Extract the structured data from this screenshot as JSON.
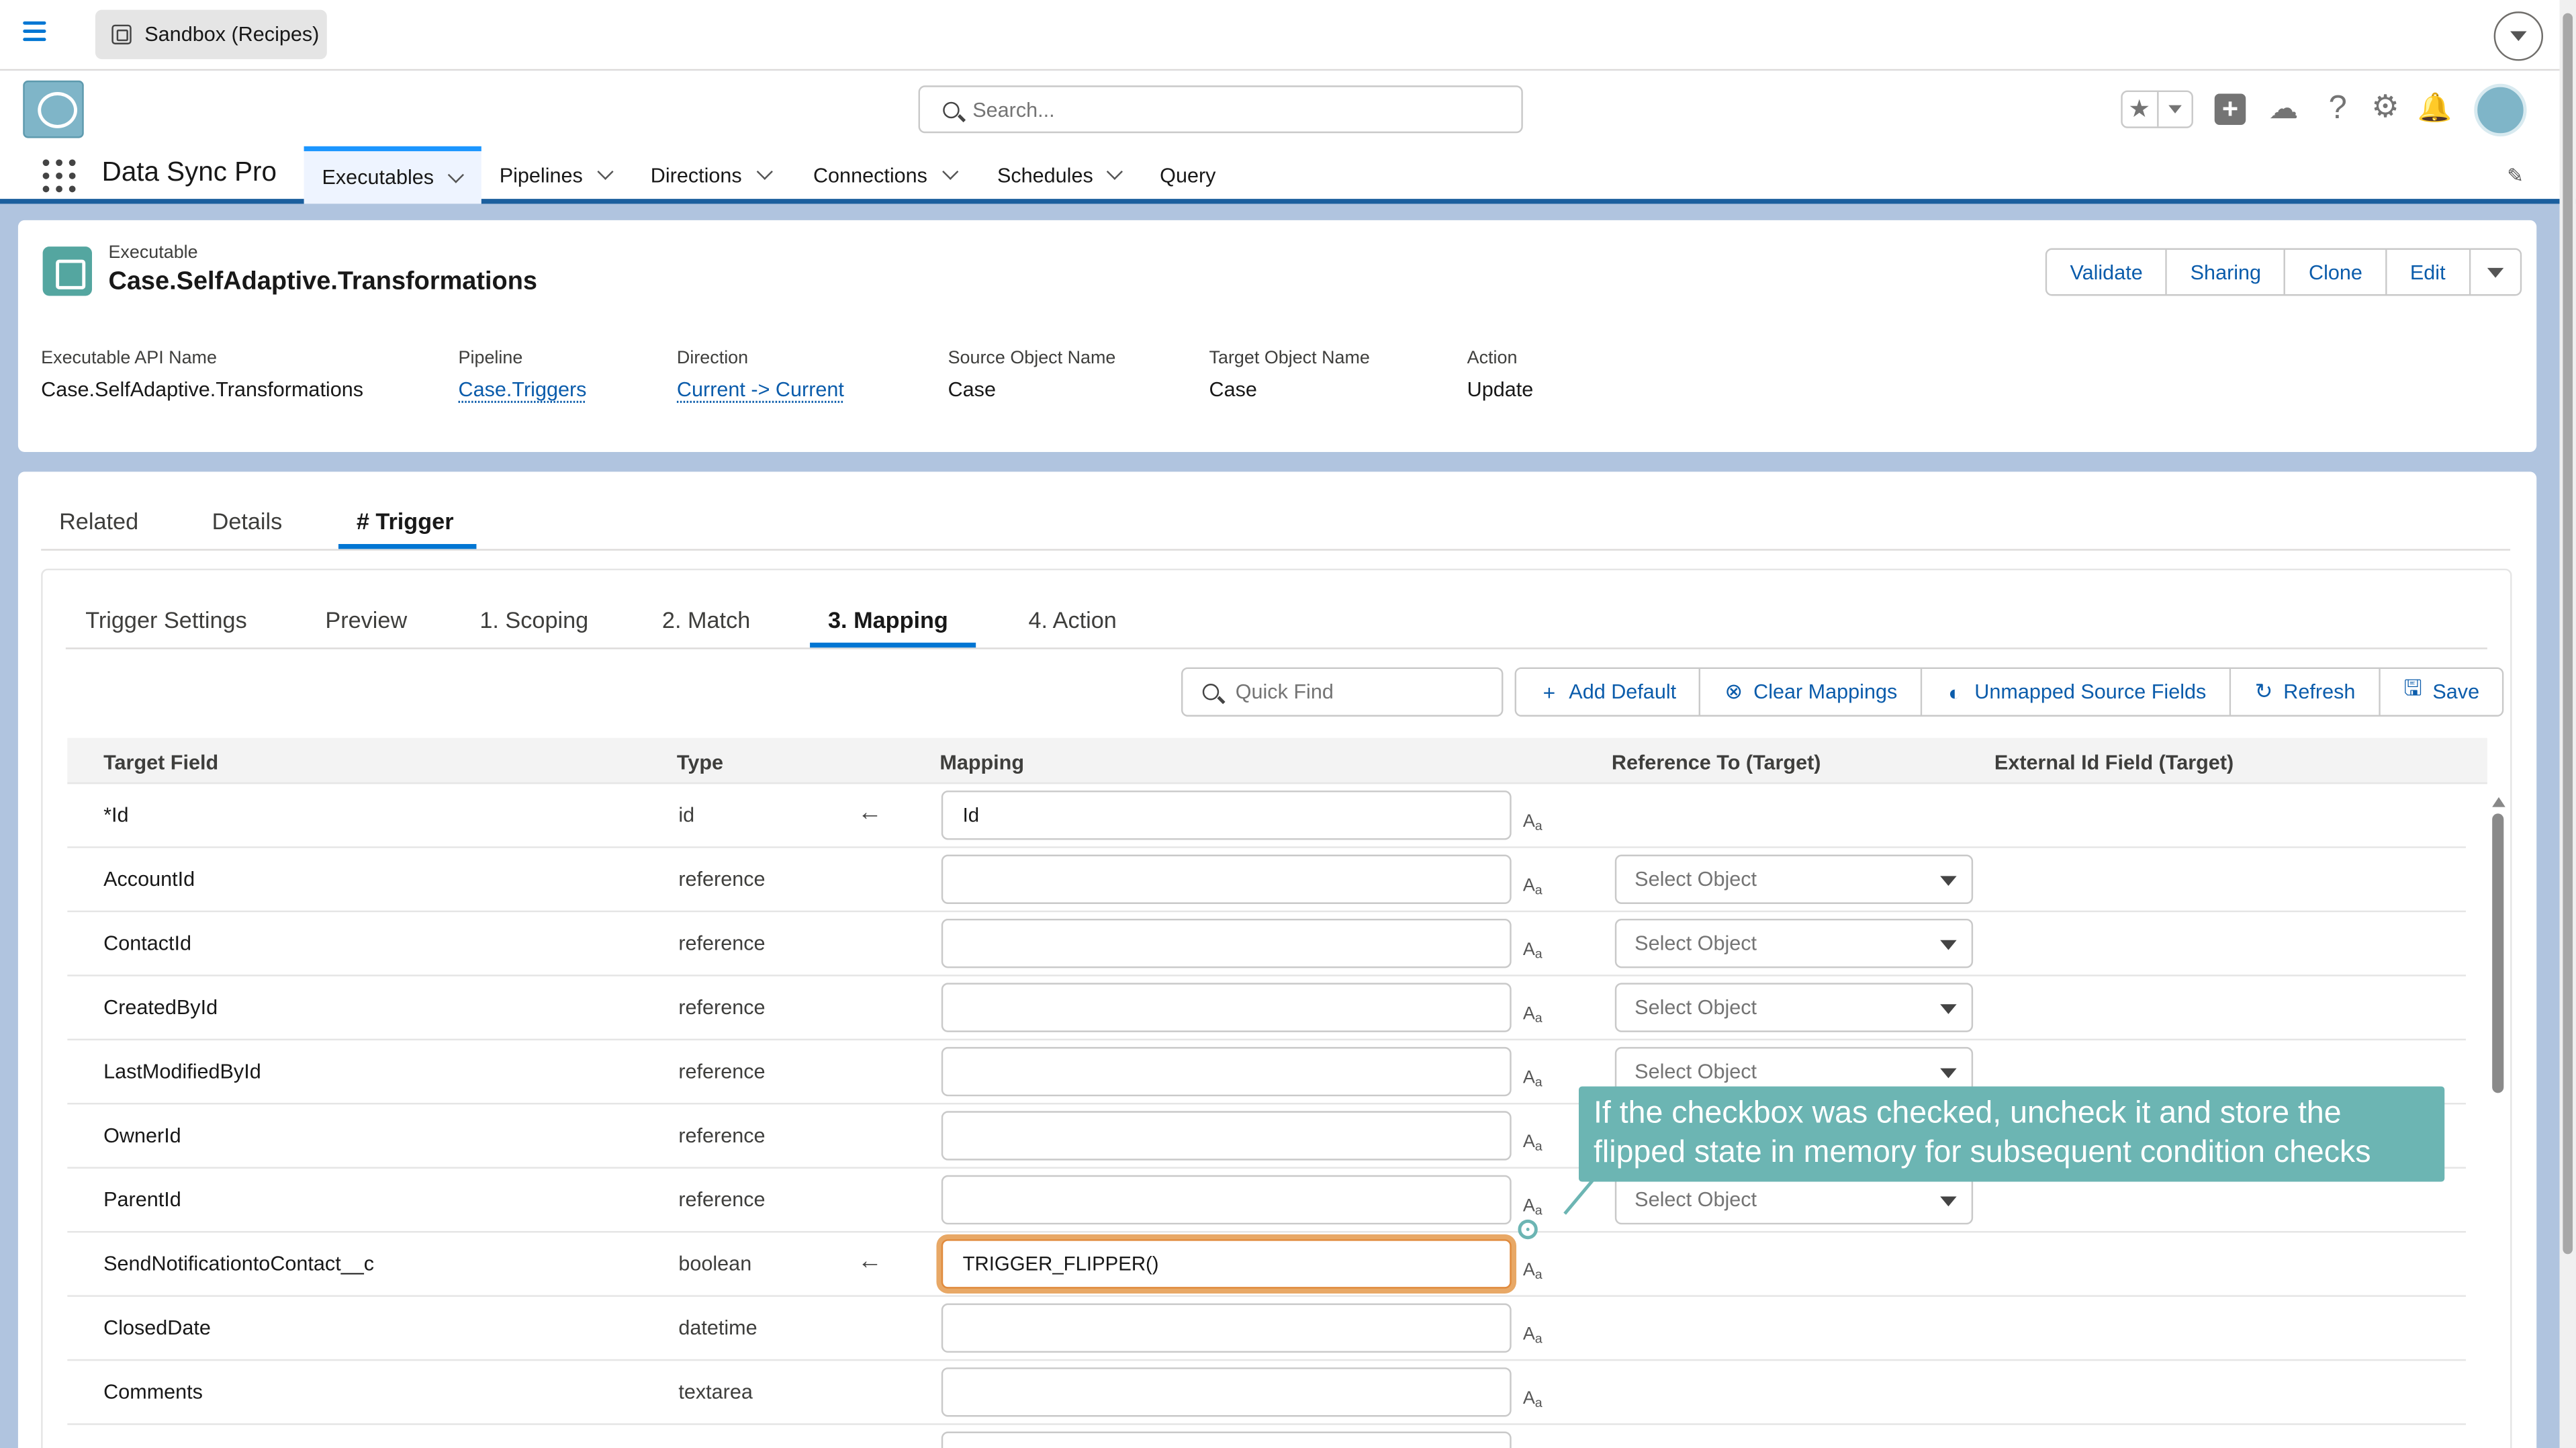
{
  "topbar": {
    "org_label": "Sandbox (Recipes)"
  },
  "header": {
    "search_placeholder": "Search...",
    "app_name": "Data Sync Pro",
    "nav": [
      {
        "label": "Executables"
      },
      {
        "label": "Pipelines"
      },
      {
        "label": "Directions"
      },
      {
        "label": "Connections"
      },
      {
        "label": "Schedules"
      },
      {
        "label": "Query"
      }
    ]
  },
  "record": {
    "type_label": "Executable",
    "title": "Case.SelfAdaptive.Transformations",
    "buttons": [
      "Validate",
      "Sharing",
      "Clone",
      "Edit"
    ],
    "fields": [
      {
        "label": "Executable API Name",
        "value": "Case.SelfAdaptive.Transformations"
      },
      {
        "label": "Pipeline",
        "value": "Case.Triggers"
      },
      {
        "label": "Direction",
        "value": "Current -> Current"
      },
      {
        "label": "Source Object Name",
        "value": "Case"
      },
      {
        "label": "Target Object Name",
        "value": "Case"
      },
      {
        "label": "Action",
        "value": "Update"
      }
    ]
  },
  "tabs": [
    "Related",
    "Details",
    "# Trigger"
  ],
  "subtabs": [
    "Trigger Settings",
    "Preview",
    "1. Scoping",
    "2. Match",
    "3. Mapping",
    "4. Action"
  ],
  "toolbar": {
    "quickfind_placeholder": "Quick Find",
    "add_default": "Add Default",
    "clear_mappings": "Clear Mappings",
    "unmapped_source_fields": "Unmapped Source Fields",
    "refresh": "Refresh",
    "save": "Save"
  },
  "table": {
    "columns": [
      "Target Field",
      "Type",
      "Mapping",
      "Reference To (Target)",
      "External Id Field (Target)"
    ],
    "select_placeholder": "Select Object",
    "rows": [
      {
        "field": "*Id",
        "type": "id",
        "mapping": "Id"
      },
      {
        "field": "AccountId",
        "type": "reference",
        "mapping": ""
      },
      {
        "field": "ContactId",
        "type": "reference",
        "mapping": ""
      },
      {
        "field": "CreatedById",
        "type": "reference",
        "mapping": ""
      },
      {
        "field": "LastModifiedById",
        "type": "reference",
        "mapping": ""
      },
      {
        "field": "OwnerId",
        "type": "reference",
        "mapping": ""
      },
      {
        "field": "ParentId",
        "type": "reference",
        "mapping": ""
      },
      {
        "field": "SendNotificationtoContact__c",
        "type": "boolean",
        "mapping": "TRIGGER_FLIPPER()"
      },
      {
        "field": "ClosedDate",
        "type": "datetime",
        "mapping": ""
      },
      {
        "field": "Comments",
        "type": "textarea",
        "mapping": ""
      }
    ]
  },
  "callout": {
    "text": "If the checkbox was checked, uncheck it and store the flipped state in memory for subsequent condition checks",
    "color": "#6cb5b3"
  },
  "colors": {
    "accent": "#0176d3",
    "link": "#0b5cab",
    "highlight": "#e08a3c"
  }
}
